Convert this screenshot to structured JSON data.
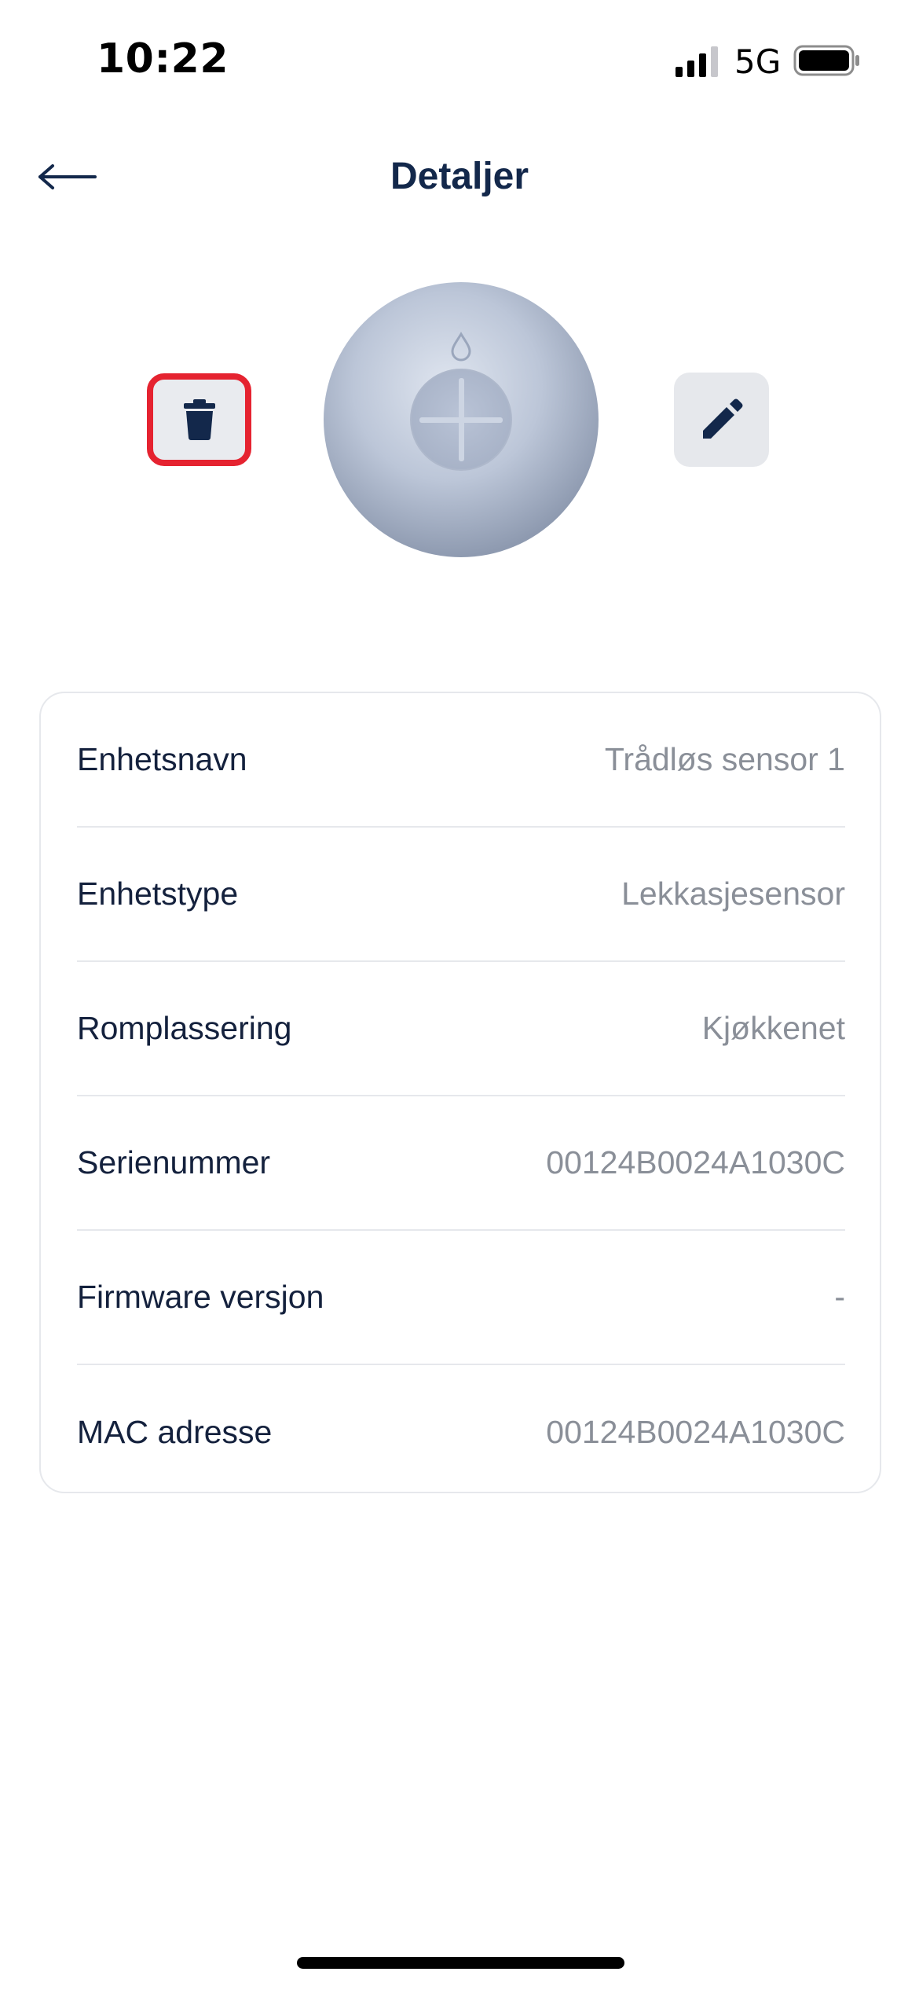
{
  "status_bar": {
    "time": "10:22",
    "network": "5G",
    "signal_icon": "cellular-signal-icon",
    "battery_icon": "battery-icon"
  },
  "header": {
    "title": "Detaljer",
    "back_icon": "arrow-left-icon"
  },
  "device": {
    "image": "leak-sensor-device",
    "delete_icon": "trash-icon",
    "edit_icon": "pencil-icon",
    "delete_highlight_color": "#e52330"
  },
  "details": [
    {
      "label": "Enhetsnavn",
      "value": "Trådløs sensor 1"
    },
    {
      "label": "Enhetstype",
      "value": "Lekkasjesensor"
    },
    {
      "label": "Romplassering",
      "value": "Kjøkkenet"
    },
    {
      "label": "Serienummer",
      "value": "00124B0024A1030C"
    },
    {
      "label": "Firmware versjon",
      "value": "-"
    },
    {
      "label": "MAC adresse",
      "value": "00124B0024A1030C"
    }
  ],
  "colors": {
    "title": "#13284b",
    "label": "#14213d",
    "value": "#8a8f98",
    "divider": "#e6e8ec",
    "button_bg": "#e6e8ec",
    "icon": "#13284b"
  }
}
